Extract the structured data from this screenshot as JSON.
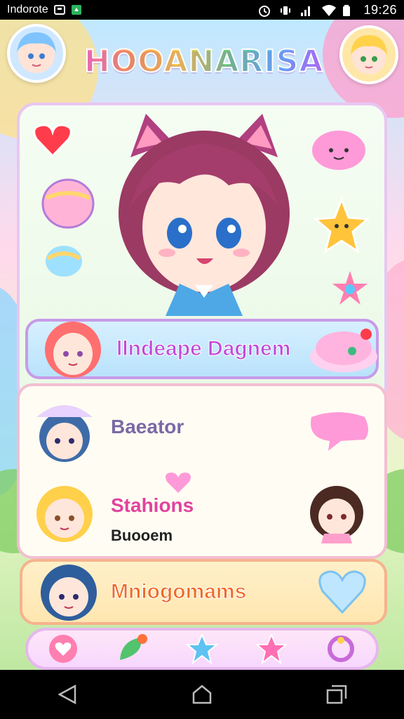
{
  "status_bar": {
    "app_label": "Indorote",
    "time": "19:26",
    "icons": [
      "notification-icon",
      "app-icon",
      "alarm-icon",
      "vibrate-icon",
      "signal-icon",
      "wifi-icon",
      "battery-icon"
    ]
  },
  "header": {
    "title": "HOOANARISA"
  },
  "hero": {
    "banner_label": "llndeape Dagnem"
  },
  "list": {
    "items": [
      {
        "label": "Baeator",
        "sub": ""
      },
      {
        "label": "Stahions",
        "sub": "Buooem"
      }
    ]
  },
  "orange": {
    "label": "Mniogomams"
  },
  "nav": {
    "items": [
      "heart-icon",
      "leaf-icon",
      "star-icon",
      "star-icon",
      "ring-icon"
    ]
  },
  "colors": {
    "accent_purple": "#c04ad8",
    "accent_orange": "#f06a2a",
    "accent_pink": "#ff6fb3"
  }
}
